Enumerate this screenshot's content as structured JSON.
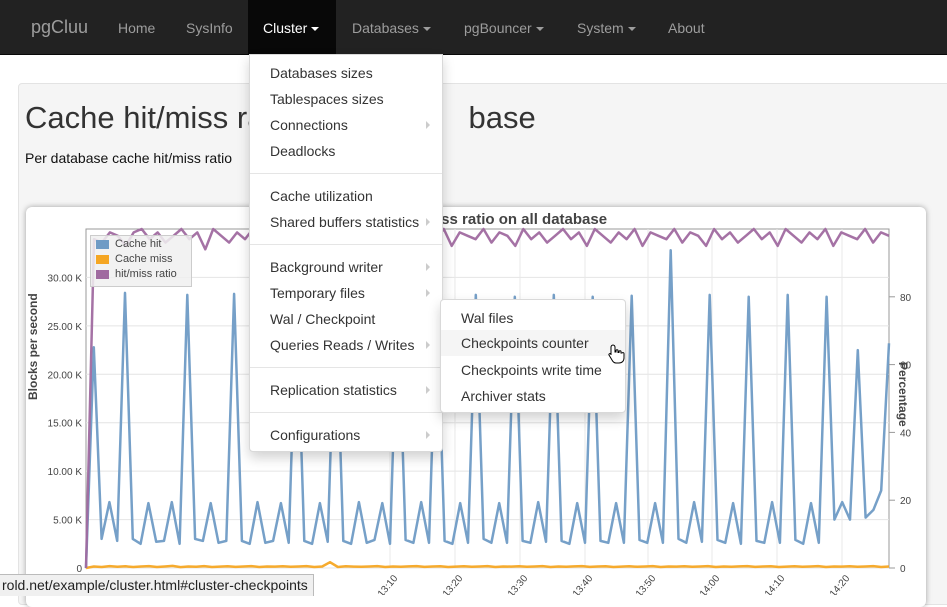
{
  "navbar": {
    "brand": "pgCluu",
    "items": [
      {
        "label": "Home"
      },
      {
        "label": "SysInfo"
      },
      {
        "label": "Cluster"
      },
      {
        "label": "Databases"
      },
      {
        "label": "pgBouncer"
      },
      {
        "label": "System"
      },
      {
        "label": "About"
      }
    ]
  },
  "page": {
    "title_left": "Cache hit/miss ra",
    "title_right": "base",
    "subtitle": "Per database cache hit/miss ratio"
  },
  "cluster_menu": {
    "items": [
      "Databases sizes",
      "Tablespaces sizes",
      "Connections",
      "Deadlocks",
      "Cache utilization",
      "Shared buffers statistics",
      "Background writer",
      "Temporary files",
      "Wal / Checkpoint",
      "Queries Reads / Writes",
      "Replication statistics",
      "Configurations"
    ]
  },
  "wal_submenu": {
    "items": [
      "Wal files",
      "Checkpoints counter",
      "Checkpoints write time",
      "Archiver stats"
    ],
    "highlighted": "Checkpoints counter"
  },
  "status_bar": {
    "url": "rold.net/example/cluster.html#cluster-checkpoints"
  },
  "chart_data": {
    "type": "line",
    "title_visible": "iss ratio on all database",
    "ylabel": "Blocks per second",
    "y2label": "Percentage",
    "ylim": [
      0,
      35000
    ],
    "y_ticks": [
      "0",
      "5.00 K",
      "10.00 K",
      "15.00 K",
      "20.00 K",
      "25.00 K",
      "30.00 K"
    ],
    "y2lim": [
      0,
      100
    ],
    "y2_ticks": [
      "0",
      "20",
      "40",
      "60",
      "80"
    ],
    "x_ticks": [
      "13:10",
      "13:20",
      "13:30",
      "13:40",
      "13:50",
      "14:00",
      "14:10",
      "14:20"
    ],
    "legend": [
      {
        "name": "Cache hit",
        "color": "#6f9bc5"
      },
      {
        "name": "Cache miss",
        "color": "#f5a623"
      },
      {
        "name": "hit/miss ratio",
        "color": "#a06aa0"
      }
    ],
    "series": [
      {
        "name": "Cache hit",
        "values": [
          0,
          22800,
          3000,
          6800,
          2800,
          28400,
          3000,
          2500,
          6700,
          2700,
          2800,
          6800,
          2500,
          28200,
          3000,
          2800,
          6700,
          2600,
          2800,
          28300,
          2800,
          2500,
          6800,
          2600,
          2800,
          6700,
          2600,
          28000,
          2800,
          2500,
          6700,
          2700,
          28200,
          2800,
          2500,
          6800,
          2600,
          2900,
          6700,
          2500,
          28200,
          2900,
          2600,
          6800,
          2600,
          28000,
          2800,
          2500,
          6700,
          2600,
          28200,
          3000,
          2600,
          6700,
          2600,
          28000,
          2800,
          2600,
          6800,
          2700,
          28200,
          2800,
          2500,
          6700,
          2600,
          28000,
          2800,
          2600,
          6700,
          2600,
          28100,
          2900,
          2600,
          6700,
          2600,
          32800,
          3000,
          2600,
          6800,
          2700,
          28200,
          2900,
          2600,
          6700,
          2500,
          28000,
          2800,
          2600,
          6800,
          2600,
          28200,
          2900,
          2500,
          6700,
          2600,
          28000,
          5000,
          6800,
          5000,
          22500,
          5200,
          6000,
          8000,
          23200
        ]
      },
      {
        "name": "Cache miss",
        "values": [
          0,
          150,
          100,
          200,
          120,
          180,
          100,
          150,
          200,
          100,
          150,
          220,
          90,
          160,
          120,
          200,
          100,
          140,
          180,
          110,
          160,
          200,
          100,
          150,
          140,
          180,
          120,
          160,
          200,
          100,
          150,
          600,
          100,
          180,
          140,
          120,
          160,
          200,
          100,
          150,
          130,
          170,
          200,
          110,
          160,
          190,
          100,
          140,
          180,
          120,
          160,
          200,
          100,
          150,
          140,
          180,
          120,
          160,
          200,
          100,
          150,
          130,
          170,
          200,
          110,
          160,
          190,
          100,
          140,
          180,
          120,
          160,
          200,
          100,
          150,
          140,
          180,
          120,
          160,
          200,
          100,
          150,
          130,
          170,
          200,
          110,
          160,
          190,
          100,
          140,
          180,
          120,
          160,
          200,
          100,
          150,
          140,
          180,
          120,
          160,
          200,
          100,
          150
        ]
      },
      {
        "name": "hit/miss ratio",
        "values": [
          0,
          97,
          96,
          99,
          98,
          95,
          99,
          100,
          97,
          99,
          96,
          98,
          100,
          97,
          99,
          94,
          100,
          98,
          96,
          99,
          97,
          100,
          95,
          99,
          98,
          97,
          100,
          96,
          99,
          98,
          95,
          100,
          97,
          99,
          96,
          98,
          100,
          97,
          99,
          95,
          100,
          98,
          96,
          99,
          97,
          100,
          95,
          99,
          98,
          97,
          100,
          96,
          99,
          98,
          95,
          100,
          97,
          99,
          96,
          98,
          100,
          97,
          99,
          95,
          100,
          98,
          96,
          99,
          97,
          100,
          95,
          99,
          98,
          97,
          100,
          96,
          99,
          98,
          95,
          100,
          97,
          99,
          96,
          98,
          100,
          97,
          99,
          95,
          100,
          98,
          96,
          99,
          97,
          100,
          95,
          99,
          98,
          97,
          100,
          96,
          99,
          98
        ]
      }
    ]
  }
}
